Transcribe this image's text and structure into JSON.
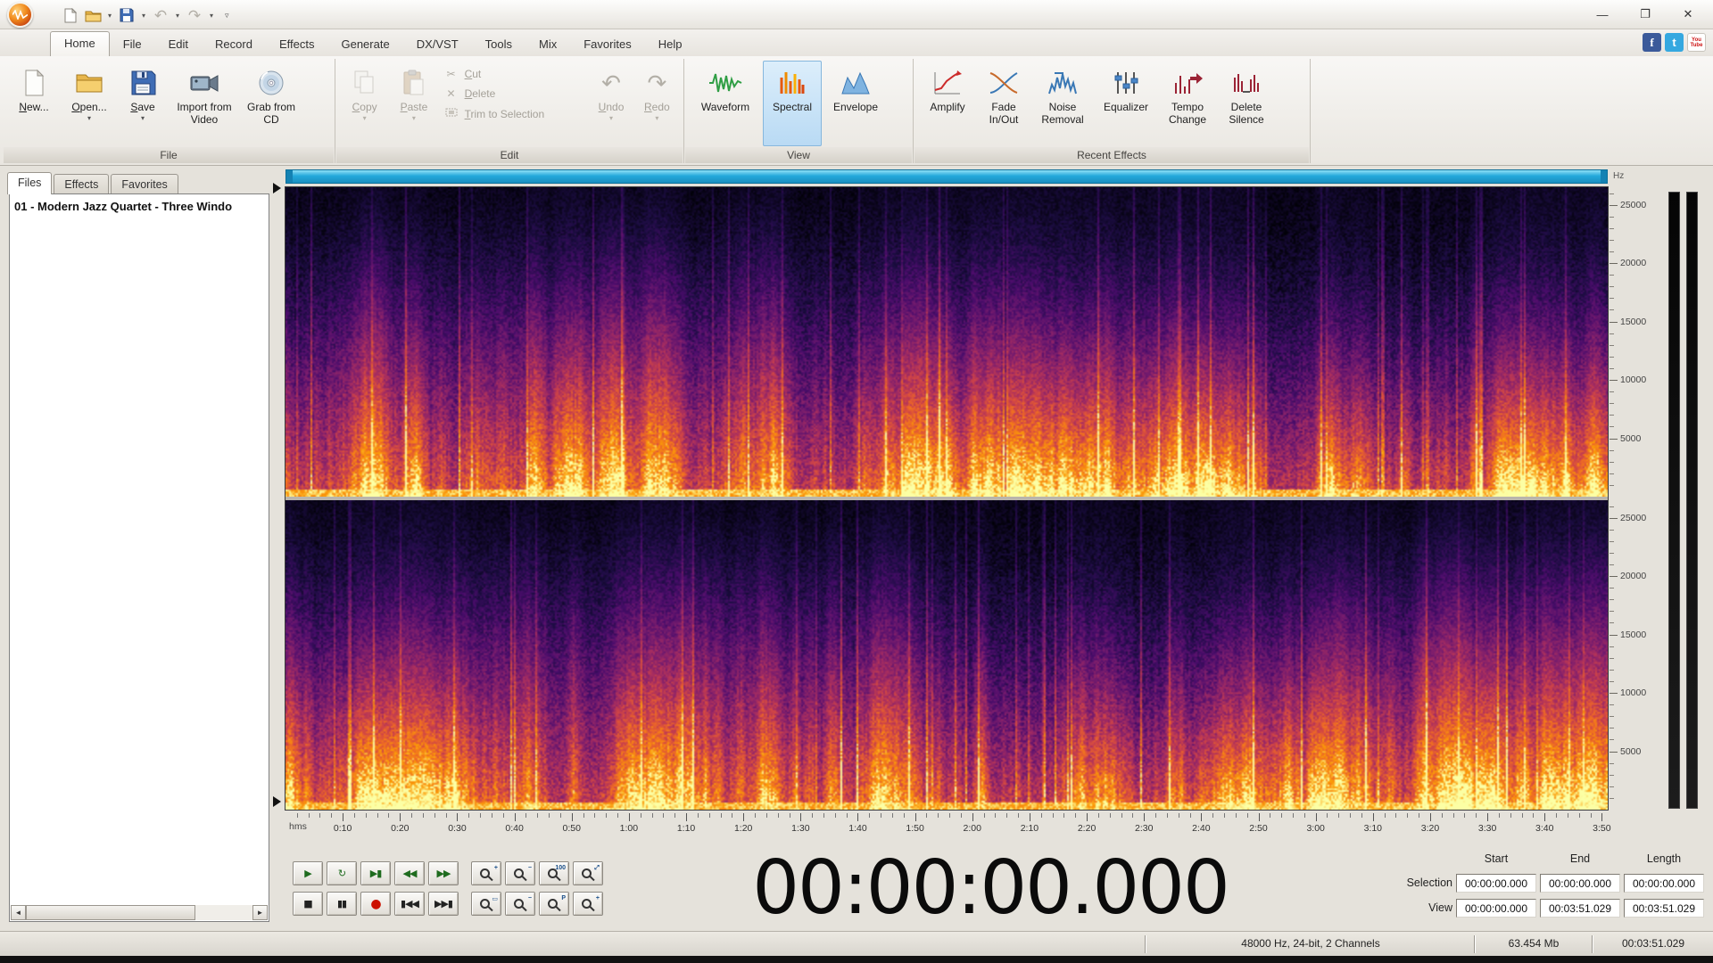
{
  "glyphs": {
    "dropdown": "▾",
    "overflow": "▿",
    "minimize": "—",
    "maximize": "❐",
    "close": "✕",
    "cut": "✂",
    "delete": "✕",
    "undo": "↶",
    "redo": "↷",
    "scroll_left": "◄",
    "scroll_right": "►"
  },
  "menu": {
    "tabs": [
      "Home",
      "File",
      "Edit",
      "Record",
      "Effects",
      "Generate",
      "DX/VST",
      "Tools",
      "Mix",
      "Favorites",
      "Help"
    ],
    "active_tab": "Home"
  },
  "social": {
    "facebook": "f",
    "twitter": "t",
    "youtube": "You\nTube"
  },
  "ribbon": {
    "file": {
      "label": "File",
      "new": "New...",
      "open": "Open...",
      "save": "Save",
      "import_video": "Import from Video",
      "grab_cd": "Grab from CD"
    },
    "edit": {
      "label": "Edit",
      "copy": "Copy",
      "paste": "Paste",
      "cut": "Cut",
      "del": "Delete",
      "trim": "Trim to Selection",
      "undo": "Undo",
      "redo": "Redo"
    },
    "view": {
      "label": "View",
      "waveform": "Waveform",
      "spectral": "Spectral",
      "envelope": "Envelope",
      "active": "Spectral"
    },
    "effects": {
      "label": "Recent Effects",
      "amplify": "Amplify",
      "fade": "Fade In/Out",
      "noise": "Noise Removal",
      "equalizer": "Equalizer",
      "tempo": "Tempo Change",
      "silence": "Delete Silence"
    }
  },
  "sidebar": {
    "tabs": [
      "Files",
      "Effects",
      "Favorites"
    ],
    "active_tab": "Files",
    "files": [
      "01 - Modern Jazz Quartet - Three Windo"
    ]
  },
  "rulers": {
    "freq_unit": "Hz",
    "freq_labels": [
      "25000",
      "20000",
      "15000",
      "10000",
      "5000"
    ],
    "freq_top_hz": 26500,
    "time_unit": "hms",
    "time_ticks": [
      "0:10",
      "0:20",
      "0:30",
      "0:40",
      "0:50",
      "1:00",
      "1:10",
      "1:20",
      "1:30",
      "1:40",
      "1:50",
      "2:00",
      "2:10",
      "2:20",
      "2:30",
      "2:40",
      "2:50",
      "3:00",
      "3:10",
      "3:20",
      "3:30",
      "3:40",
      "3:50"
    ],
    "duration_seconds": 231.029
  },
  "transport": {
    "row1": [
      {
        "name": "play",
        "glyph": "▶"
      },
      {
        "name": "loop",
        "glyph": "↻"
      },
      {
        "name": "play-from-cursor",
        "glyph": "▶▮"
      },
      {
        "name": "rewind",
        "glyph": "◀◀"
      },
      {
        "name": "fast-forward",
        "glyph": "▶▶"
      }
    ],
    "row2": [
      {
        "name": "stop",
        "glyph": "■"
      },
      {
        "name": "pause",
        "glyph": "▮▮"
      },
      {
        "name": "record",
        "glyph": "●"
      },
      {
        "name": "go-to-start",
        "glyph": "▮◀◀"
      },
      {
        "name": "go-to-end",
        "glyph": "▶▶▮"
      }
    ],
    "zoom_row1": [
      {
        "name": "zoom-in",
        "overlay": "+"
      },
      {
        "name": "zoom-out",
        "overlay": "−"
      },
      {
        "name": "zoom-100",
        "overlay": "100"
      },
      {
        "name": "zoom-selection",
        "overlay": "⤢"
      }
    ],
    "zoom_row2": [
      {
        "name": "zoom-full",
        "overlay": "▭"
      },
      {
        "name": "zoom-vertical-out",
        "overlay": "−"
      },
      {
        "name": "zoom-project",
        "overlay": "P"
      },
      {
        "name": "zoom-vertical-in",
        "overlay": "+"
      }
    ]
  },
  "time_display": "00:00:00.000",
  "selection_panel": {
    "headers": [
      "Start",
      "End",
      "Length"
    ],
    "rows": [
      {
        "label": "Selection",
        "values": [
          "00:00:00.000",
          "00:00:00.000",
          "00:00:00.000"
        ]
      },
      {
        "label": "View",
        "values": [
          "00:00:00.000",
          "00:03:51.029",
          "00:03:51.029"
        ]
      }
    ]
  },
  "statusbar": {
    "format": "48000 Hz, 24-bit, 2 Channels",
    "size": "63.454 Mb",
    "duration": "00:03:51.029"
  }
}
